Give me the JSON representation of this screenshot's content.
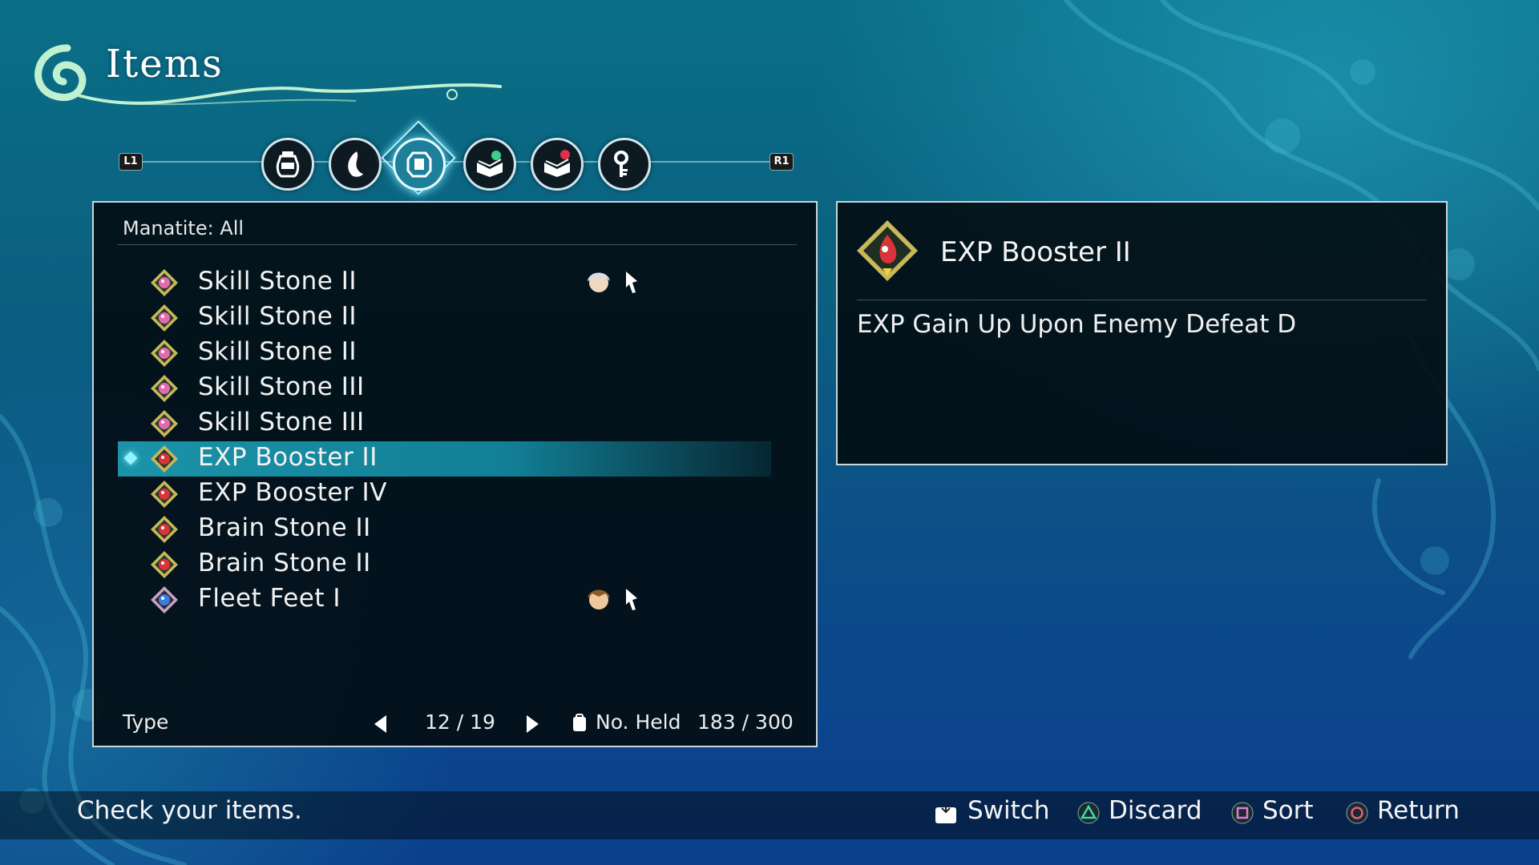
{
  "screen": {
    "title": "Items"
  },
  "tabs": {
    "left_shoulder": "L1",
    "right_shoulder": "R1",
    "items": [
      {
        "icon": "potion-jar-icon"
      },
      {
        "icon": "feather-icon"
      },
      {
        "icon": "manatite-gem-icon",
        "active": true
      },
      {
        "icon": "book-green-icon"
      },
      {
        "icon": "book-red-icon"
      },
      {
        "icon": "key-icon"
      }
    ]
  },
  "list": {
    "header": "Manatite: All",
    "rows": [
      {
        "label": "Skill Stone II",
        "gem": "pink",
        "equipped": true,
        "char": "silver-hair"
      },
      {
        "label": "Skill Stone II",
        "gem": "pink"
      },
      {
        "label": "Skill Stone II",
        "gem": "pink"
      },
      {
        "label": "Skill Stone III",
        "gem": "pink"
      },
      {
        "label": "Skill Stone III",
        "gem": "pink"
      },
      {
        "label": "EXP Booster II",
        "gem": "red",
        "selected": true
      },
      {
        "label": "EXP Booster IV",
        "gem": "red"
      },
      {
        "label": "Brain Stone II",
        "gem": "red"
      },
      {
        "label": "Brain Stone II",
        "gem": "red"
      },
      {
        "label": "Fleet Feet I",
        "gem": "blue",
        "equipped": true,
        "char": "brown-hair"
      }
    ],
    "footer": {
      "type_label": "Type",
      "page": "12 / 19",
      "held_label": "No. Held",
      "held_value": "183 / 300"
    }
  },
  "detail": {
    "name": "EXP Booster II",
    "description": "EXP Gain Up Upon Enemy Defeat D"
  },
  "bottom": {
    "help": "Check your items.",
    "buttons": [
      {
        "label": "Switch",
        "icon": "touchpad-icon"
      },
      {
        "label": "Discard",
        "icon": "triangle-button-icon"
      },
      {
        "label": "Sort",
        "icon": "square-button-icon"
      },
      {
        "label": "Return",
        "icon": "circle-button-icon"
      }
    ]
  },
  "colors": {
    "accent": "#1a93a8",
    "panel_bg": "#030e14",
    "gem_pink": "#e46ab0",
    "gem_red": "#d8343a",
    "gem_blue": "#3a7fe0",
    "gem_frame": "#c9b85a"
  }
}
